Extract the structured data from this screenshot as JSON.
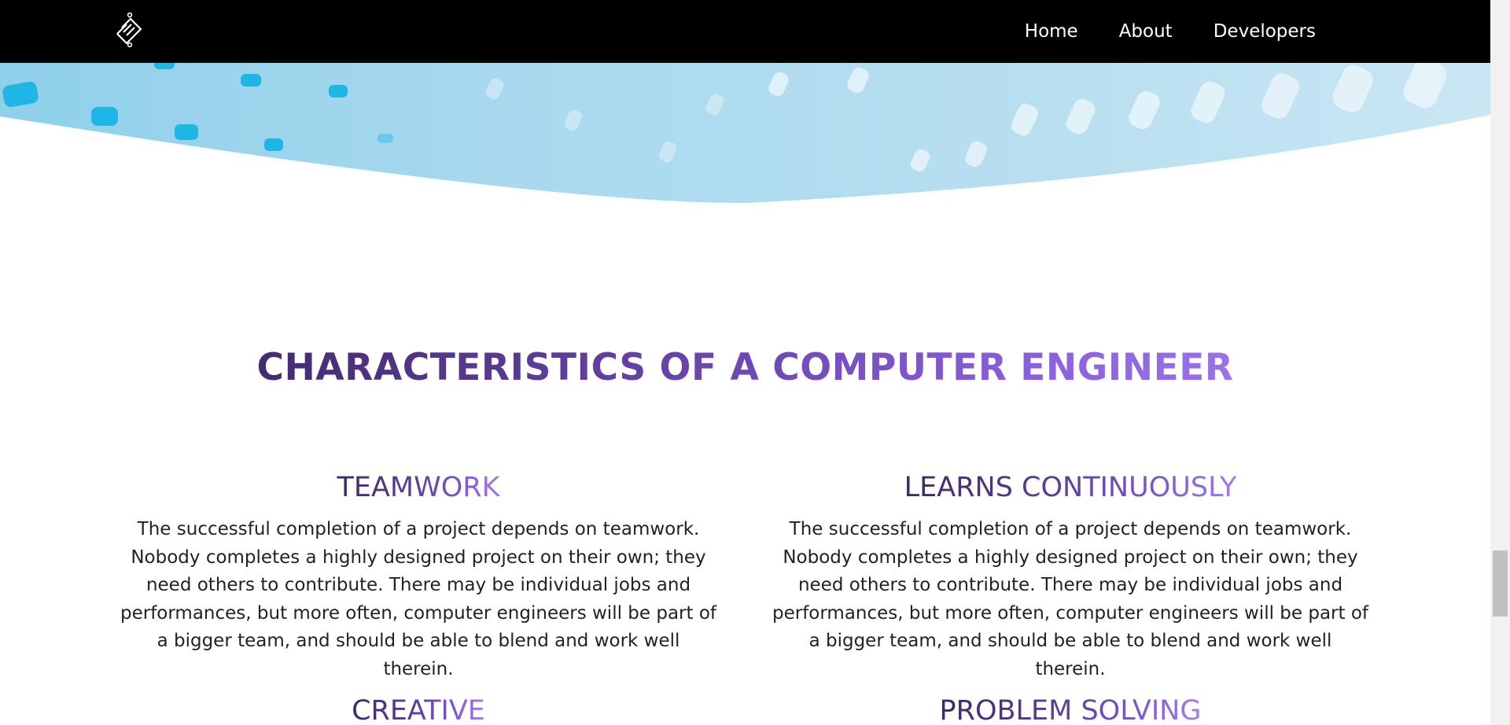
{
  "nav": {
    "logo_icon": "circuit-logo-icon",
    "items": [
      {
        "label": "Home"
      },
      {
        "label": "About"
      },
      {
        "label": "Developers"
      }
    ]
  },
  "main": {
    "title": "CHARACTERISTICS OF A COMPUTER ENGINEER",
    "sections": [
      {
        "heading": "TEAMWORK",
        "body": "The successful completion of a project depends on teamwork. Nobody completes a highly designed project on their own; they need others to contribute. There may be individual jobs and performances, but more often, computer engineers will be part of a bigger team, and should be able to blend and work well therein."
      },
      {
        "heading": "LEARNS CONTINUOUSLY",
        "body": "The successful completion of a project depends on teamwork. Nobody completes a highly designed project on their own; they need others to contribute. There may be individual jobs and performances, but more often, computer engineers will be part of a bigger team, and should be able to blend and work well therein."
      },
      {
        "heading": "CREATIVE",
        "body": ""
      },
      {
        "heading": "PROBLEM SOLVING",
        "body": ""
      }
    ]
  },
  "colors": {
    "header_bg": "#000000",
    "title_gradient_start": "#2e1f4f",
    "title_gradient_end": "#b08af7",
    "hero_blue": "#bfe2f2",
    "body_text": "#222222"
  }
}
